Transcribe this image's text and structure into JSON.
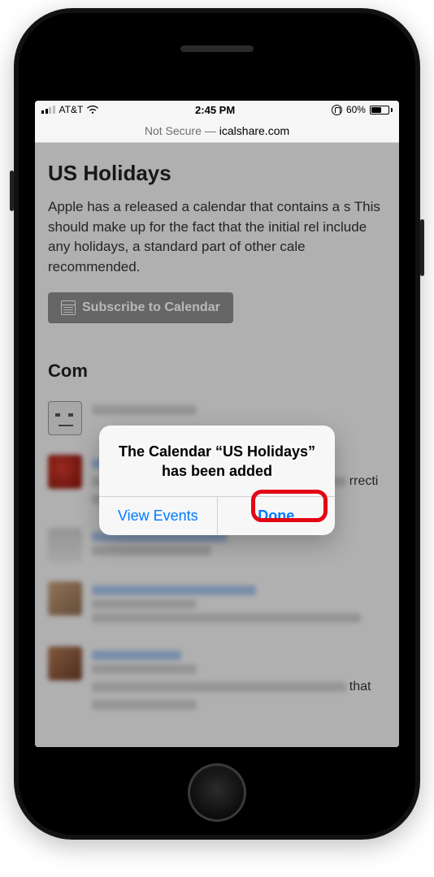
{
  "status": {
    "carrier": "AT&T",
    "time": "2:45 PM",
    "battery_pct": "60%"
  },
  "url": {
    "secure_label": "Not Secure —",
    "host": "icalshare.com"
  },
  "page": {
    "title": "US Holidays",
    "description": "Apple has a released a calendar that contains a s This should make up for the fact that the initial rel include any holidays, a standard part of other cale recommended.",
    "subscribe_label": "Subscribe to Calendar",
    "comments_heading": "Com",
    "trailing_1": "rrecti",
    "trailing_2": "that"
  },
  "alert": {
    "title": "The Calendar “US Holidays” has been added",
    "view_events_label": "View Events",
    "done_label": "Done"
  }
}
